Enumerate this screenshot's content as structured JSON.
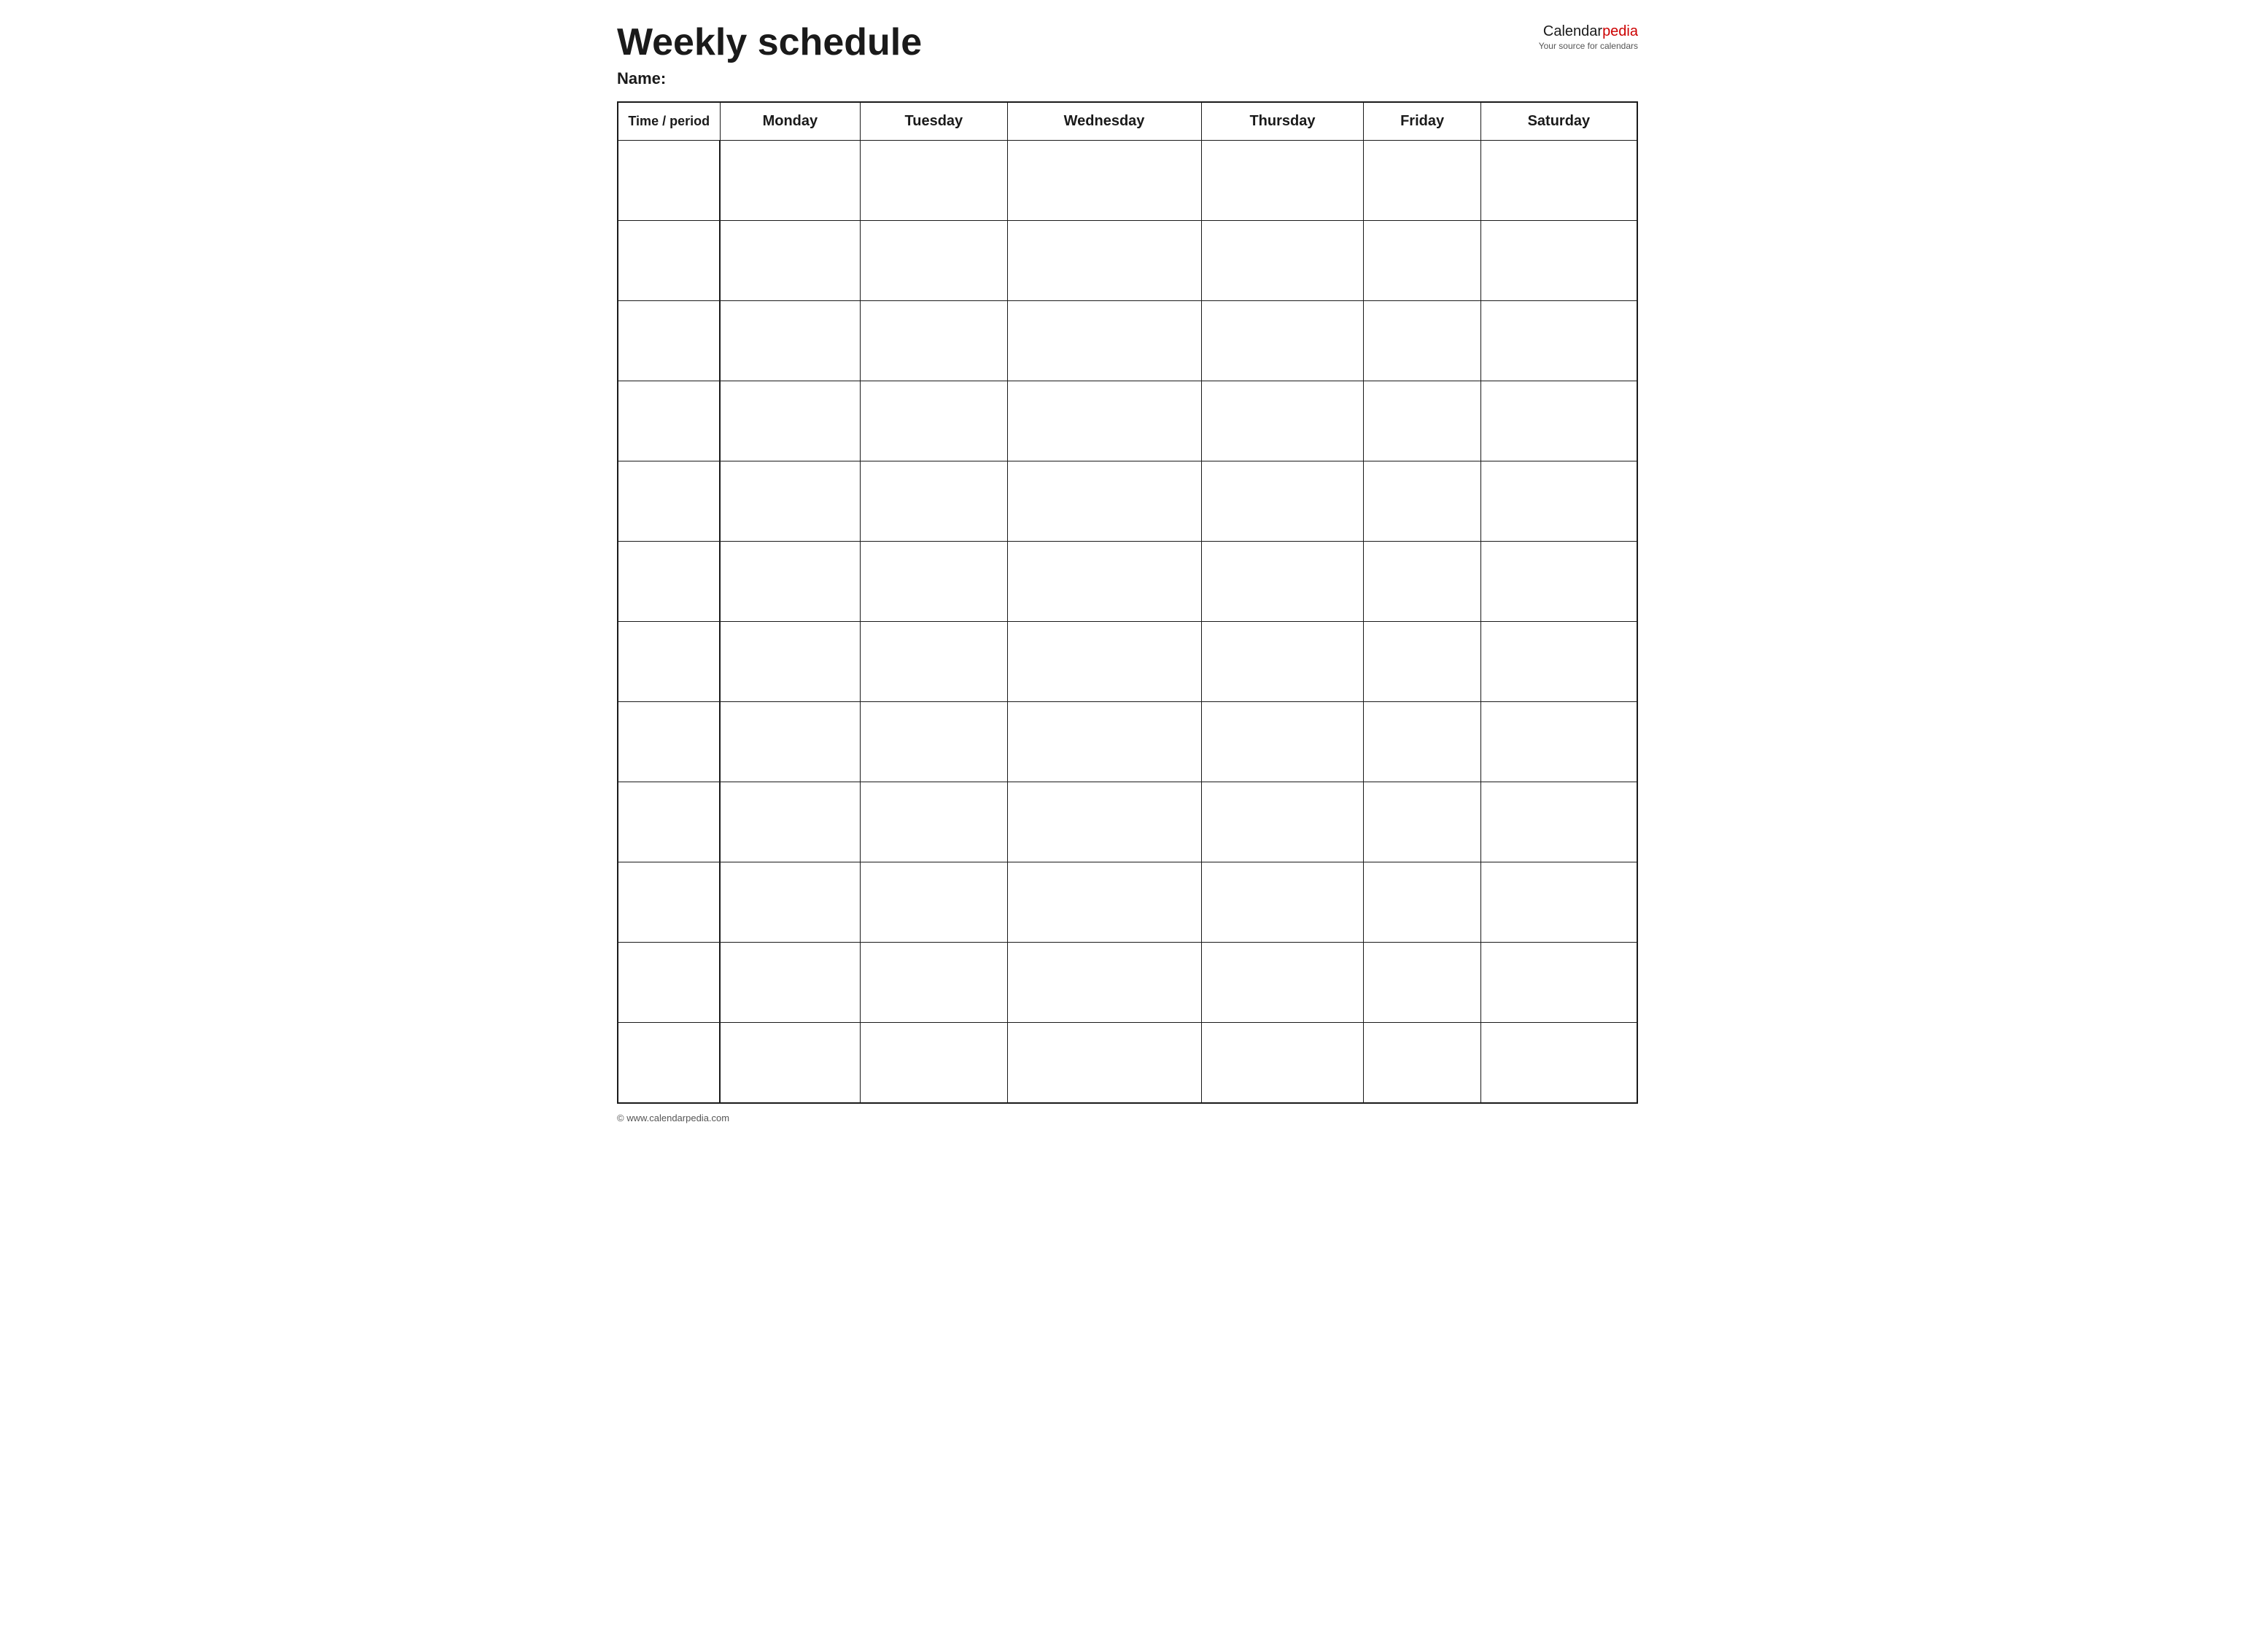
{
  "header": {
    "title": "Weekly schedule",
    "logo": {
      "brand_black": "Calendar",
      "brand_red": "pedia",
      "tagline": "Your source for calendars"
    },
    "name_label": "Name:"
  },
  "table": {
    "columns": [
      {
        "label": "Time / period"
      },
      {
        "label": "Monday"
      },
      {
        "label": "Tuesday"
      },
      {
        "label": "Wednesday"
      },
      {
        "label": "Thursday"
      },
      {
        "label": "Friday"
      },
      {
        "label": "Saturday"
      }
    ],
    "row_count": 12
  },
  "footer": {
    "text": "© www.calendarpedia.com"
  }
}
